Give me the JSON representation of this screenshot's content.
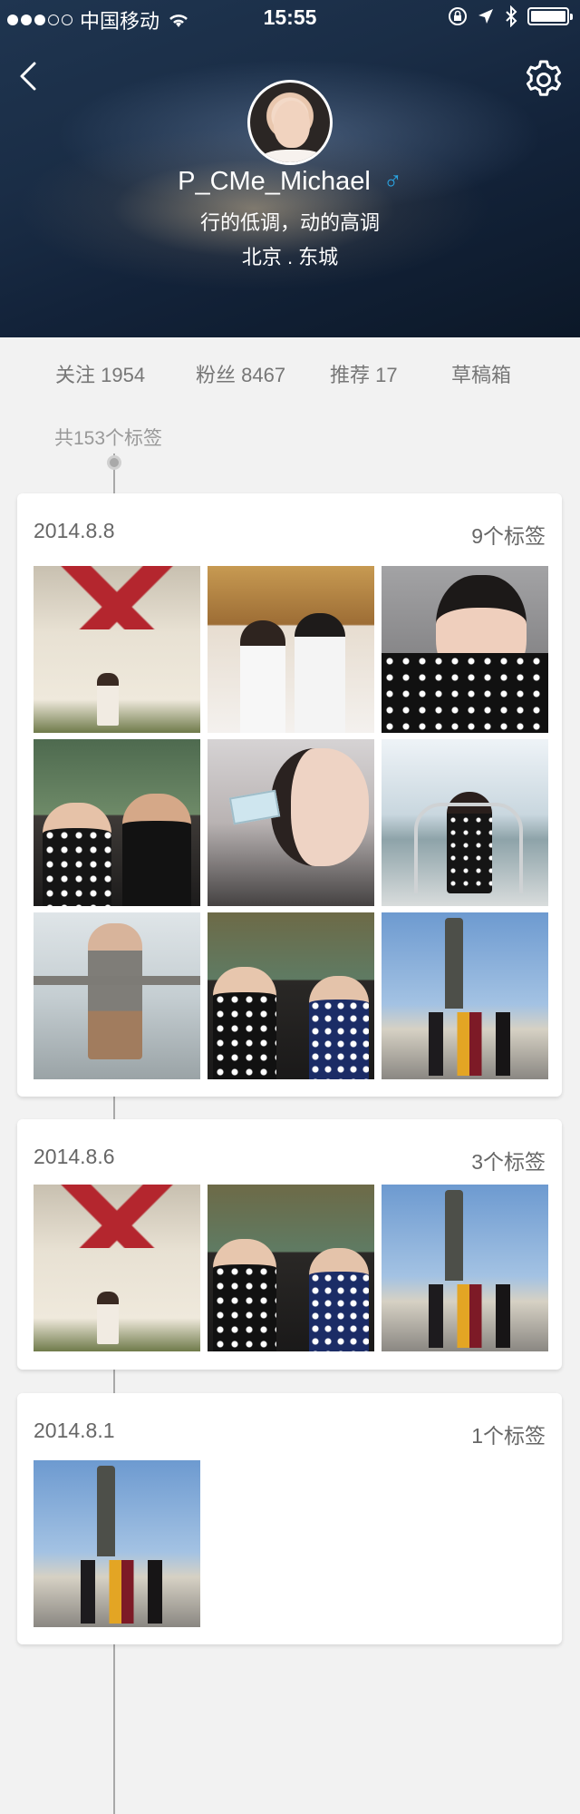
{
  "status_bar": {
    "carrier": "中国移动",
    "time": "15:55",
    "battery_level": 1.0
  },
  "profile": {
    "username": "P_CMe_Michael",
    "gender_symbol": "♂",
    "signature": "行的低调，动的高调",
    "location": "北京 . 东城"
  },
  "stats": {
    "following": "关注 1954",
    "followers": "粉丝 8467",
    "recommended": "推荐 17",
    "drafts": "草稿箱"
  },
  "timeline": {
    "total_tags": "共153个标签",
    "groups": [
      {
        "date": "2014.8.8",
        "count": "9个标签"
      },
      {
        "date": "2014.8.6",
        "count": "3个标签"
      },
      {
        "date": "2014.8.1",
        "count": "1个标签"
      }
    ]
  },
  "icons": {
    "back": "chevron-left-icon",
    "settings": "gear-icon",
    "wifi": "wifi-icon",
    "lock": "rotation-lock-icon",
    "location": "location-arrow-icon",
    "bluetooth": "bluetooth-icon",
    "battery": "battery-icon"
  },
  "colors": {
    "gender": "#2aa7e6",
    "background": "#f2f2f2",
    "card": "#ffffff"
  }
}
